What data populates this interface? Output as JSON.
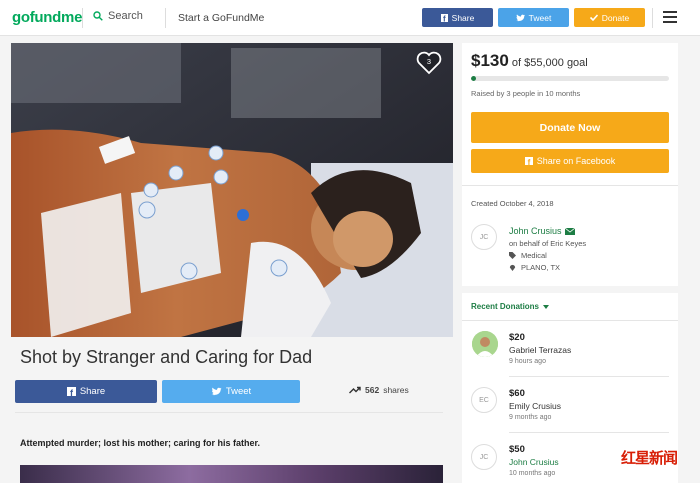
{
  "header": {
    "logo_part1": "go",
    "logo_part2": "fund",
    "logo_part3": "me",
    "search_label": "Search",
    "start_label": "Start a GoFundMe",
    "share_label": "Share",
    "tweet_label": "Tweet",
    "donate_label": "Donate",
    "icons": [
      "search-icon",
      "facebook-icon",
      "twitter-icon",
      "check-icon",
      "hamburger-menu-icon"
    ]
  },
  "campaign": {
    "heart_count": "3",
    "title": "Shot by Stranger and Caring for Dad",
    "share_label": "Share",
    "tweet_label": "Tweet",
    "shares_count": "562",
    "shares_label": "shares",
    "story_text": "Attempted murder; lost his mother; caring for his father."
  },
  "sidebar": {
    "raised_amount": "$130",
    "goal_text": "of $55,000 goal",
    "progress_percent": 2.5,
    "raised_by": "Raised by 3 people in 10 months",
    "donate_now_label": "Donate Now",
    "share_facebook_label": "Share on Facebook",
    "created": "Created October 4, 2018",
    "organizer": {
      "initials": "JC",
      "name": "John Crusius",
      "on_behalf": "on behalf of Eric Keyes",
      "category": "Medical",
      "location": "PLANO, TX"
    }
  },
  "recent": {
    "heading": "Recent Donations",
    "donations": [
      {
        "amount": "$20",
        "name": "Gabriel Terrazas",
        "time": "9 hours ago",
        "initials": ""
      },
      {
        "amount": "$60",
        "name": "Emily Crusius",
        "time": "9 months ago",
        "initials": "EC"
      },
      {
        "amount": "$50",
        "name": "John Crusius",
        "time": "10 months ago",
        "initials": "JC"
      }
    ]
  },
  "watermark": "红星新闻",
  "colors": {
    "brand_green": "#02a95c",
    "facebook": "#3b5998",
    "twitter": "#55acee",
    "donate_orange": "#f6a919",
    "link_green": "#1d7d44"
  }
}
